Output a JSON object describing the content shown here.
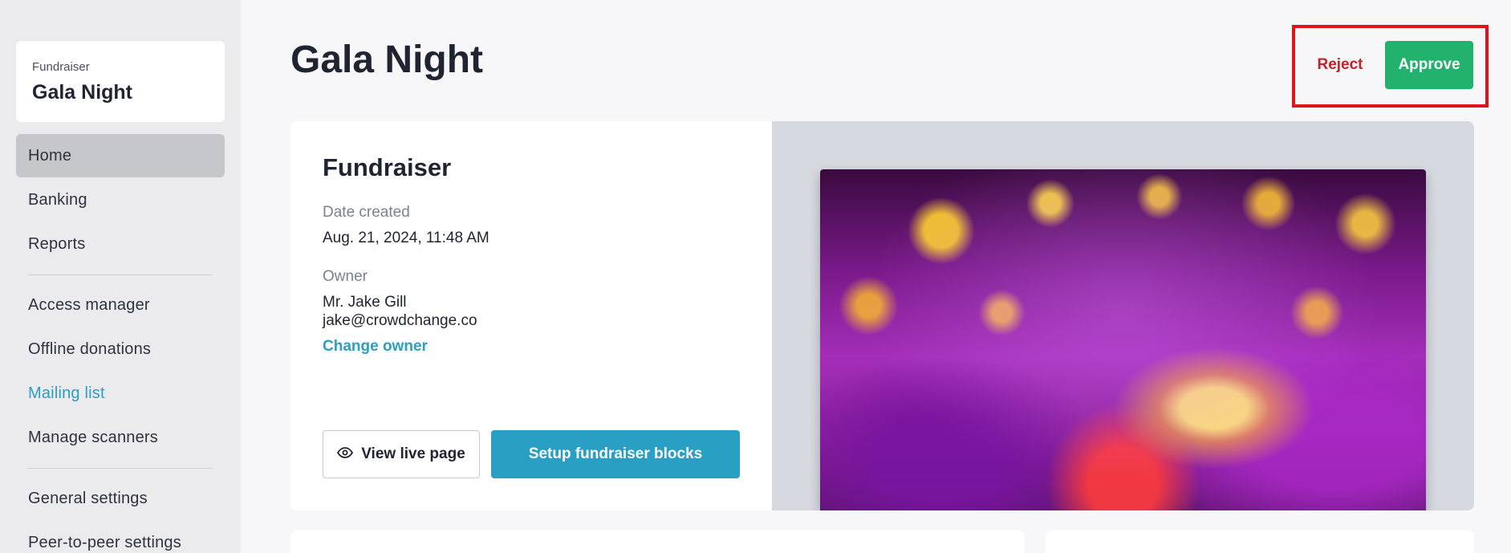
{
  "sidebar": {
    "org_type": "Fundraiser",
    "org_name": "Gala Night",
    "items": [
      {
        "label": "Home"
      },
      {
        "label": "Banking"
      },
      {
        "label": "Reports"
      },
      {
        "label": "Access manager"
      },
      {
        "label": "Offline donations"
      },
      {
        "label": "Mailing list"
      },
      {
        "label": "Manage scanners"
      },
      {
        "label": "General settings"
      },
      {
        "label": "Peer-to-peer settings"
      }
    ]
  },
  "header": {
    "title": "Gala Night",
    "reject_label": "Reject",
    "approve_label": "Approve"
  },
  "card": {
    "section_title": "Fundraiser",
    "date_label": "Date created",
    "date_value": "Aug. 21, 2024, 11:48 AM",
    "owner_label": "Owner",
    "owner_name": "Mr. Jake Gill",
    "owner_email": "jake@crowdchange.co",
    "change_owner_label": "Change owner",
    "view_live_label": "View live page",
    "setup_label": "Setup fundraiser blocks"
  },
  "colors": {
    "approve": "#23b26d",
    "reject": "#c8202a",
    "primary": "#2a9fc4",
    "highlight_box": "#e0131b"
  },
  "icons": {
    "view_live": "eye-icon"
  }
}
